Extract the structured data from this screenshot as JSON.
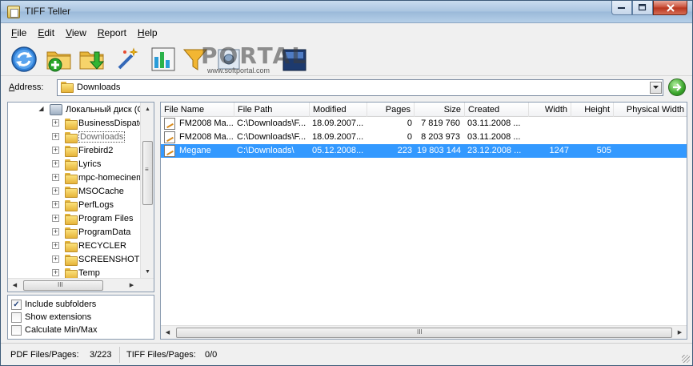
{
  "window": {
    "title": "TIFF Teller"
  },
  "menu": [
    {
      "label": "File",
      "accel": "F",
      "rest": "ile"
    },
    {
      "label": "Edit",
      "accel": "E",
      "rest": "dit"
    },
    {
      "label": "View",
      "accel": "V",
      "rest": "iew"
    },
    {
      "label": "Report",
      "accel": "R",
      "rest": "eport"
    },
    {
      "label": "Help",
      "accel": "H",
      "rest": "elp"
    }
  ],
  "toolbar": {
    "watermark": "PORTAL",
    "watermark_sub": "www.softportal.com"
  },
  "address": {
    "label_accel": "A",
    "label_rest": "ddress:",
    "value": "Downloads"
  },
  "tree": {
    "root": "Локальный диск (C",
    "items": [
      {
        "label": "BusinessDispatc"
      },
      {
        "label": "Downloads"
      },
      {
        "label": "Firebird2"
      },
      {
        "label": "Lyrics"
      },
      {
        "label": "mpc-homecinem"
      },
      {
        "label": "MSOCache"
      },
      {
        "label": "PerfLogs"
      },
      {
        "label": "Program Files"
      },
      {
        "label": "ProgramData"
      },
      {
        "label": "RECYCLER"
      },
      {
        "label": "SCREENSHOTS"
      },
      {
        "label": "Temp"
      }
    ],
    "selected_index": 1
  },
  "options": [
    {
      "label": "Include subfolders",
      "checked": true
    },
    {
      "label": "Show extensions",
      "checked": false
    },
    {
      "label": "Calculate Min/Max",
      "checked": false
    }
  ],
  "list": {
    "columns": [
      "File Name",
      "File Path",
      "Modified",
      "Pages",
      "Size",
      "Created",
      "Width",
      "Height",
      "Physical Width"
    ],
    "rows": [
      [
        "FM2008 Ma...",
        "C:\\Downloads\\F...",
        "18.09.2007...",
        "0",
        "7 819 760",
        "03.11.2008 ...",
        "",
        "",
        ""
      ],
      [
        "FM2008 Ma...",
        "C:\\Downloads\\F...",
        "18.09.2007...",
        "0",
        "8 203 973",
        "03.11.2008 ...",
        "",
        "",
        ""
      ],
      [
        "Megane",
        "C:\\Downloads\\",
        "05.12.2008...",
        "223",
        "19 803 144",
        "23.12.2008 ...",
        "1247",
        "505",
        ""
      ]
    ],
    "selected_row": 2
  },
  "status": {
    "pdf_label": "PDF Files/Pages:",
    "pdf_value": "3/223",
    "tiff_label": "TIFF Files/Pages:",
    "tiff_value": "0/0"
  }
}
